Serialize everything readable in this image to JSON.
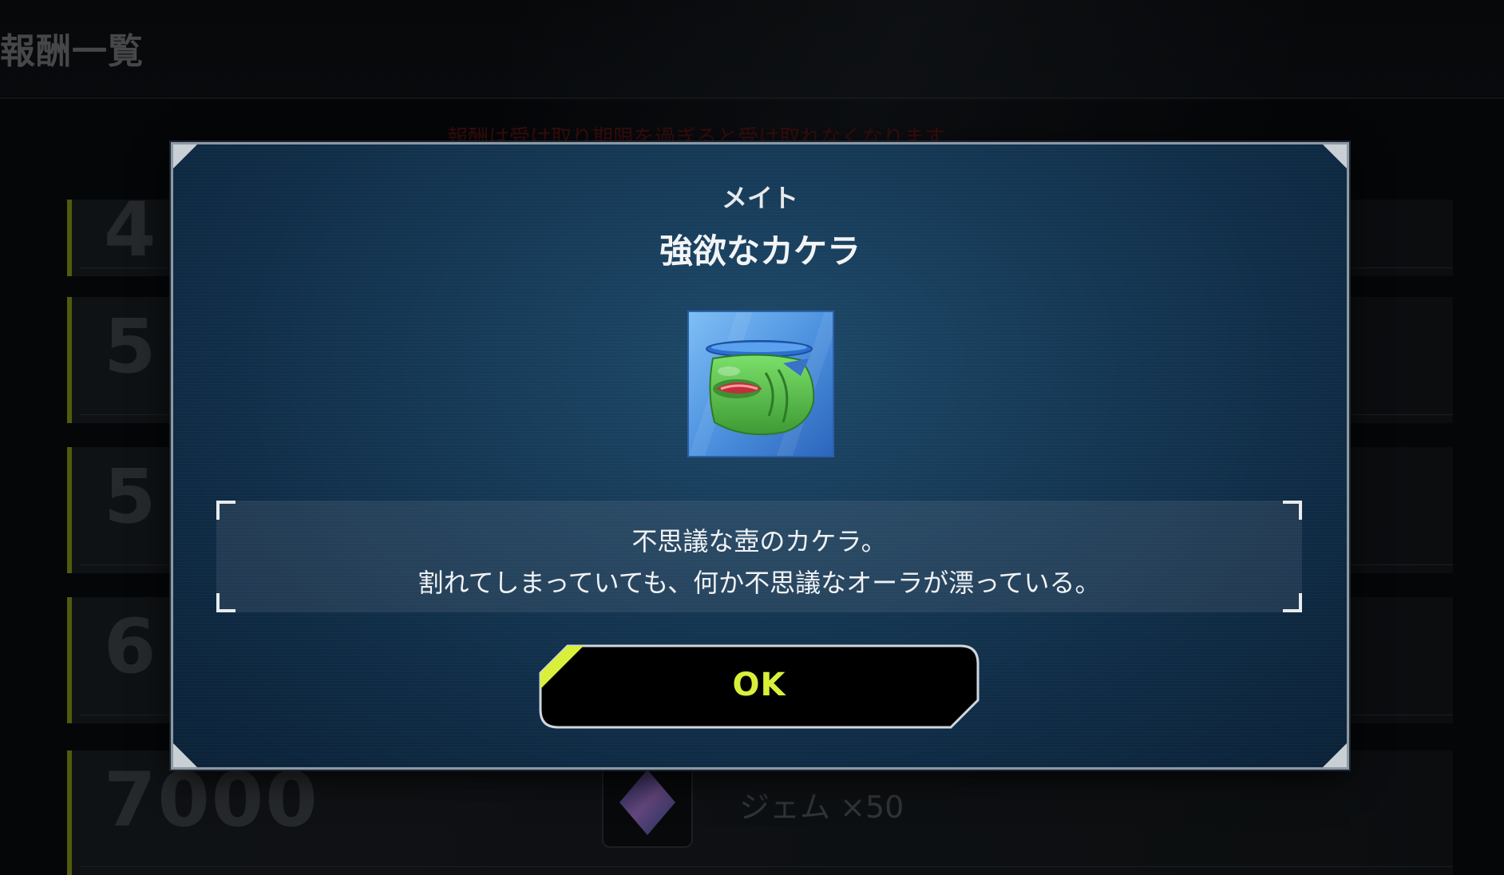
{
  "background": {
    "screen_title": "報酬一覧",
    "notice": "報酬は受け取り期限を過ぎると受け取れなくなります",
    "rows": [
      {
        "score": "4",
        "reward_name": ""
      },
      {
        "score": "5",
        "reward_name": ""
      },
      {
        "score": "5",
        "reward_name": ""
      },
      {
        "score": "6",
        "reward_name": ""
      },
      {
        "score": "7000",
        "reward_name": "ジェム ×50"
      }
    ]
  },
  "modal": {
    "category": "メイト",
    "item_name": "強欲なカケラ",
    "item_icon": "greedy-pot-shard-icon",
    "description_line1": "不思議な壺のカケラ。",
    "description_line2": "割れてしまっていても、何か不思議なオーラが漂っている。",
    "ok_label": "OK"
  },
  "colors": {
    "accent": "#d8f03a",
    "modal_bg": "#163a57",
    "modal_border": "#8d99a4",
    "row_accent": "#7d8a16"
  }
}
